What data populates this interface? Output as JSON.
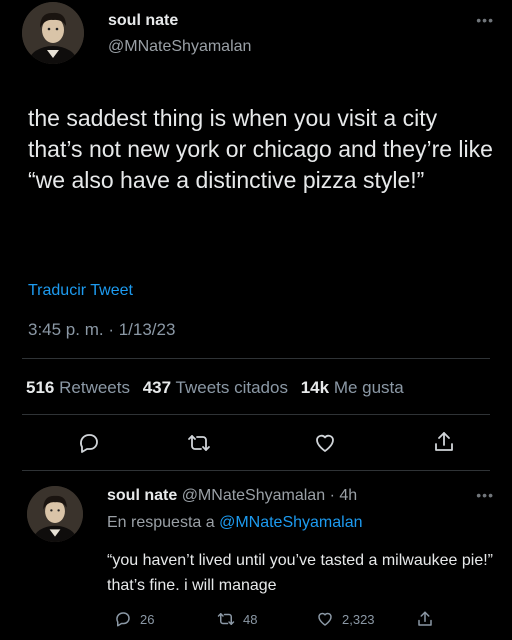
{
  "tweet": {
    "author_name": "soul nate",
    "author_handle": "@MNateShyamalan",
    "text": "the saddest thing is when you visit a city that’s not new york or chicago and they’re like “we also have a distinctive pizza style!”",
    "translate_label": "Traducir Tweet",
    "timestamp": "3:45 p. m. · 1/13/23",
    "more_icon": "more-horizontal-icon",
    "stats": {
      "retweets_count": "516",
      "retweets_label": "Retweets",
      "quotes_count": "437",
      "quotes_label": "Tweets citados",
      "likes_count": "14k",
      "likes_label": "Me gusta"
    },
    "actions": [
      "reply-icon",
      "retweet-icon",
      "like-icon",
      "share-icon"
    ]
  },
  "reply": {
    "author_name": "soul nate",
    "author_handle": "@MNateShyamalan",
    "time": "· 4h",
    "reply_prefix": "En respuesta a",
    "reply_to": "@MNateShyamalan",
    "text": "“you haven’t lived until you’ve tasted a milwaukee pie!” that’s fine. i will manage",
    "reply_count": "26",
    "retweet_count": "48",
    "like_count": "2,323"
  },
  "colors": {
    "background": "#000000",
    "text": "#e7e9ea",
    "secondary": "#8b98a5",
    "link": "#1d9bf0",
    "divider": "#2f3336"
  }
}
